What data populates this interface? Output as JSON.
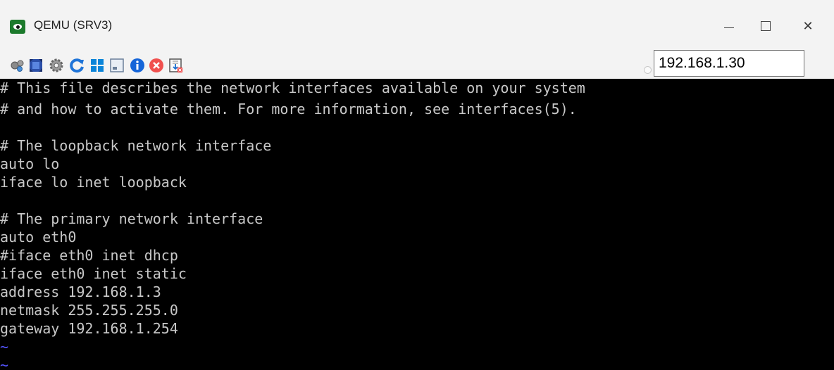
{
  "window": {
    "title": "QEMU (SRV3)",
    "controls": {
      "minimize": "—",
      "maximize": "□",
      "close": "✕"
    }
  },
  "toolbar": {
    "icons": [
      "network-icon",
      "fullscreen-icon",
      "settings-icon",
      "refresh-icon",
      "windows-icon",
      "console-icon",
      "info-icon",
      "stop-icon",
      "eject-icon"
    ],
    "ip_address": "192.168.1.30"
  },
  "terminal": {
    "lines": [
      "# This file describes the network interfaces available on your system",
      "# and how to activate them. For more information, see interfaces(5).",
      "",
      "# The loopback network interface",
      "auto lo",
      "iface lo inet loopback",
      "",
      "# The primary network interface",
      "auto eth0",
      "#iface eth0 inet dhcp",
      "iface eth0 inet static",
      "address 192.168.1.3",
      "netmask 255.255.255.0",
      "gateway 192.168.1.254",
      "~",
      "~"
    ]
  },
  "colors": {
    "terminal_bg": "#000000",
    "terminal_text": "#c8c8c8",
    "tilde": "#5555ff",
    "chrome": "#f3f3f3"
  }
}
